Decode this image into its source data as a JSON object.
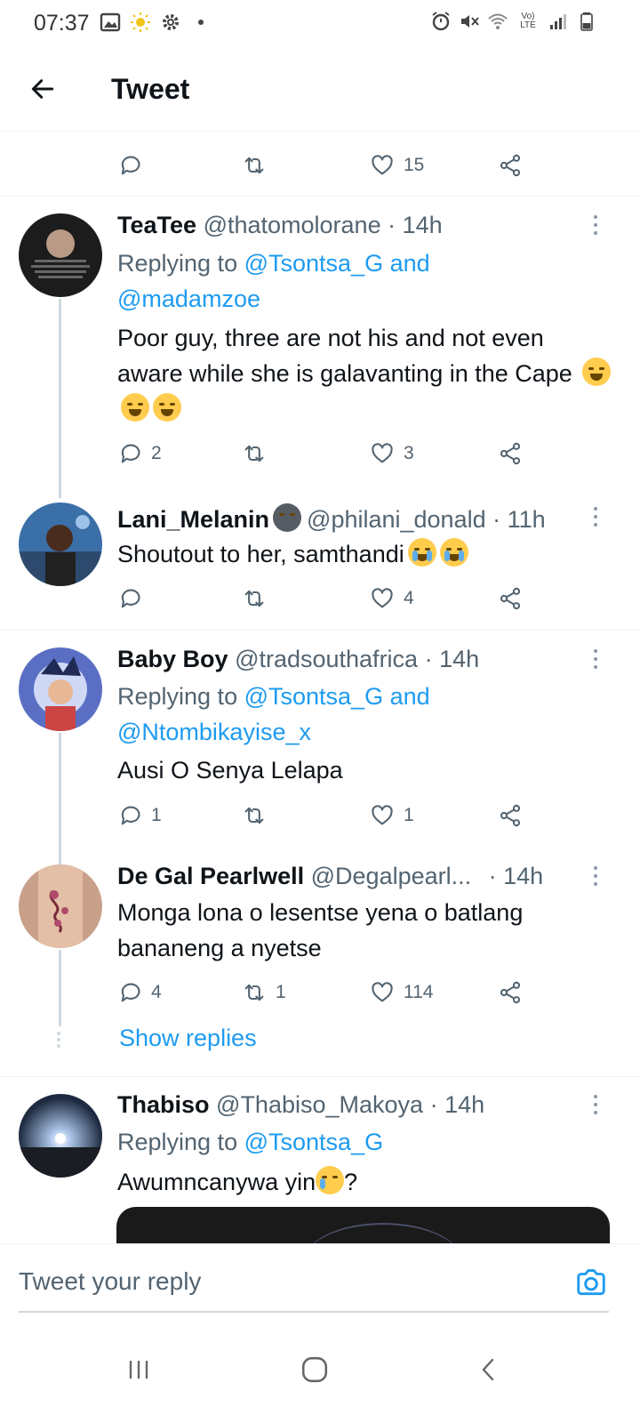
{
  "status_bar": {
    "time": "07:37",
    "network_label": "Vo) LTE"
  },
  "header": {
    "title": "Tweet"
  },
  "top_actions": {
    "like_count": "15"
  },
  "tweets": [
    {
      "name": "TeaTee",
      "handle": "@thatomolorane",
      "time": "· 14h",
      "replying_prefix": "Replying to ",
      "replying_mentions": [
        "@Tsontsa_G and",
        "@madamzoe"
      ],
      "text": "Poor guy, three are not his and not even aware while she is galavanting in the Cape",
      "reply_count": "2",
      "retweet_count": "",
      "like_count": "3"
    },
    {
      "name": "Lani_Melanin",
      "handle": "@philani_donald",
      "time": "· 11h",
      "text": "Shoutout to her, samthandi",
      "reply_count": "",
      "retweet_count": "",
      "like_count": "4"
    },
    {
      "name": "Baby Boy",
      "handle": "@tradsouthafrica",
      "time": "· 14h",
      "replying_prefix": "Replying to ",
      "replying_mentions": [
        "@Tsontsa_G and",
        "@Ntombikayise_x"
      ],
      "text": "Ausi O Senya Lelapa",
      "reply_count": "1",
      "retweet_count": "",
      "like_count": "1"
    },
    {
      "name": "De Gal Pearlwell",
      "handle": "@Degalpearl...",
      "time": "· 14h",
      "text": "Monga lona o lesentse yena o batlang bananeng a nyetse",
      "reply_count": "4",
      "retweet_count": "1",
      "like_count": "114"
    },
    {
      "name": "Thabiso",
      "handle": "@Thabiso_Makoya",
      "time": "· 14h",
      "replying_prefix": "Replying to ",
      "replying_mentions": [
        "@Tsontsa_G"
      ],
      "text": "Awumncanywa yin",
      "text_suffix": "?"
    }
  ],
  "show_replies_label": "Show replies",
  "composer": {
    "placeholder": "Tweet your reply"
  },
  "colors": {
    "accent": "#1d9bf0",
    "muted": "#536471",
    "text": "#0f1419"
  }
}
